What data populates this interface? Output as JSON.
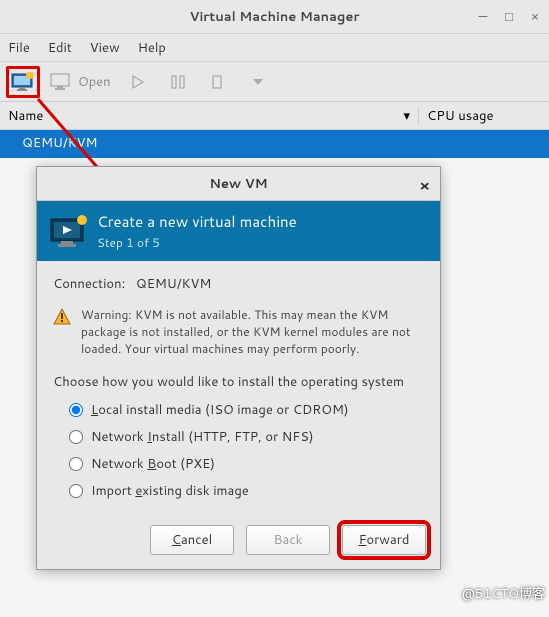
{
  "main": {
    "title": "Virtual Machine Manager",
    "menus": {
      "file": "File",
      "edit": "Edit",
      "view": "View",
      "help": "Help"
    },
    "toolbar": {
      "open_label": "Open"
    },
    "columns": {
      "name": "Name",
      "cpu": "CPU usage"
    },
    "row_selected": "QEMU/KVM"
  },
  "dialog": {
    "title": "New VM",
    "banner": {
      "heading": "Create a new virtual machine",
      "step": "Step 1 of 5"
    },
    "connection_label": "Connection:",
    "connection_value": "QEMU/KVM",
    "warning": "Warning: KVM is not available. This may mean the KVM package is not installed, or the KVM kernel modules are not loaded. Your virtual machines may perform poorly.",
    "choose_label": "Choose how you would like to install the operating system",
    "options": {
      "local": {
        "pre": "",
        "ul": "L",
        "post": "ocal install media (ISO image or CDROM)",
        "checked": true
      },
      "net_install": {
        "pre": "Network ",
        "ul": "I",
        "post": "nstall (HTTP, FTP, or NFS)",
        "checked": false
      },
      "net_boot": {
        "pre": "Network ",
        "ul": "B",
        "post": "oot (PXE)",
        "checked": false
      },
      "import": {
        "pre": "Import ",
        "ul": "e",
        "post": "xisting disk image",
        "checked": false
      }
    },
    "buttons": {
      "cancel": {
        "ul": "C",
        "rest": "ancel"
      },
      "back": "Back",
      "forward": {
        "ul": "F",
        "rest": "orward"
      }
    }
  },
  "watermark": "@51CTO博客"
}
